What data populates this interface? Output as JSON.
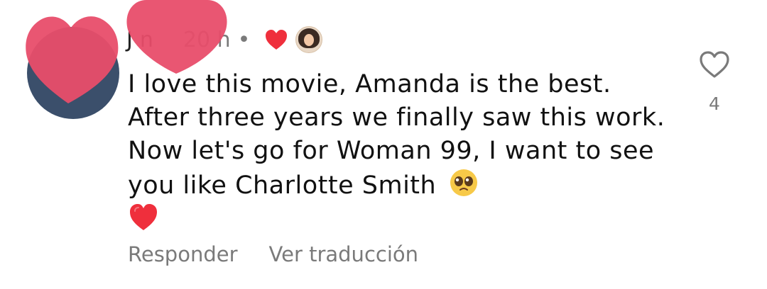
{
  "comment": {
    "username": "J",
    "username_tail": "n",
    "time": "20 h",
    "separator": "•",
    "body": "I love this movie, Amanda is the best. After three years we finally saw this work. Now let's go for Woman 99, I want to see you like Charlotte Smith",
    "like_count": "4",
    "actions": {
      "reply": "Responder",
      "translate": "Ver traducción"
    }
  },
  "icons": {
    "liked": "red-heart-icon",
    "like": "heart-outline-icon",
    "pleading_emoji": "pleading-face-emoji",
    "heart_emoji": "red-heart-emoji"
  },
  "colors": {
    "heart_red": "#ef2f3c",
    "muted_text": "#7a7a7a",
    "overlay_heart": "#e84d6a"
  }
}
